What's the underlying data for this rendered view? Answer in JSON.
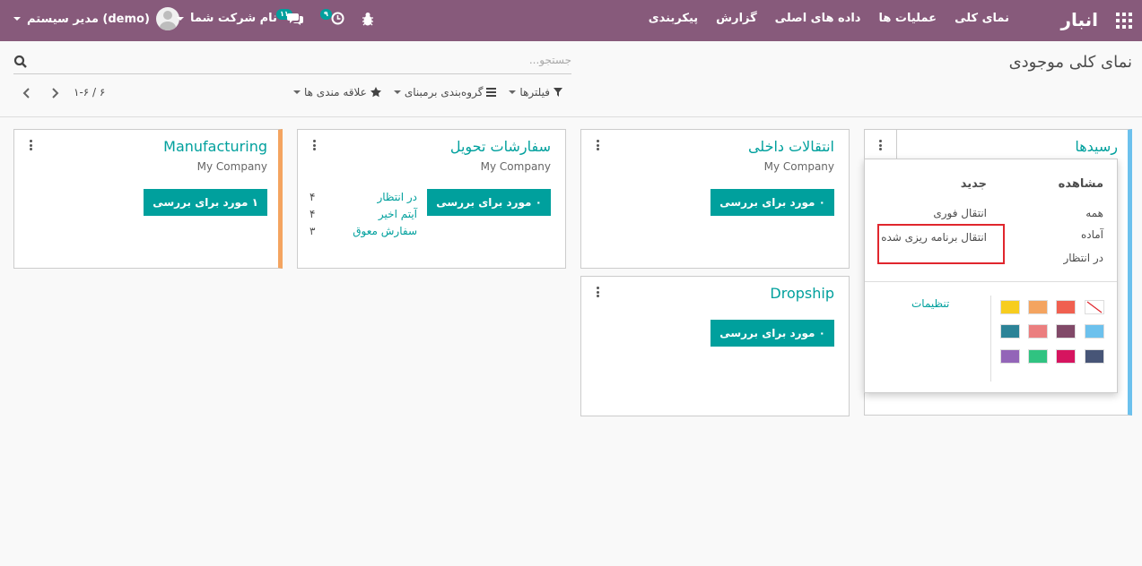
{
  "navbar": {
    "brand": "انبار",
    "menu": [
      "نمای کلی",
      "عملیات ها",
      "داده های اصلی",
      "گزارش",
      "پیکربندی"
    ],
    "user": "مدیر سیستم (demo)",
    "company": "نام شرکت شما",
    "messages_count": "۱۱",
    "activities_count": "۹",
    "color": "#875a7b"
  },
  "control_panel": {
    "title": "نمای کلی موجودی",
    "search_placeholder": "جستجو...",
    "filters_label": "فیلترها",
    "groupby_label": "گروه‌بندی برمبنای",
    "favorites_label": "علاقه مندی ها",
    "pager_value": "۱-۶ / ۶"
  },
  "cards": {
    "receipts": {
      "title": "رسیدها"
    },
    "internal": {
      "title": "انتقالات داخلی",
      "company": "My Company",
      "button": "۰ مورد برای بررسی"
    },
    "delivery": {
      "title": "سفارشات تحویل",
      "company": "My Company",
      "button": "۰ مورد برای بررسی",
      "stats": [
        {
          "label": "در انتظار",
          "count": "۴"
        },
        {
          "label": "آیتم اخیر",
          "count": "۴"
        },
        {
          "label": "سفارش معوق",
          "count": "۳"
        }
      ]
    },
    "manufacturing": {
      "title": "Manufacturing",
      "company": "My Company",
      "button": "۱ مورد برای بررسی"
    },
    "dropship": {
      "title": "Dropship",
      "button": "۰ مورد برای بررسی"
    }
  },
  "dropdown": {
    "view_header": "مشاهده",
    "new_header": "جدید",
    "view_items": [
      "همه",
      "آماده",
      "در انتظار"
    ],
    "new_items": [
      "انتقال فوری",
      "انتقال برنامه ریزی شده"
    ],
    "settings": "تنظیمات",
    "swatches": [
      "none",
      "#f06050",
      "#f4a460",
      "#f7cd1f",
      "#6cc1ed",
      "#814968",
      "#eb7e7f",
      "#2c8397",
      "#475577",
      "#d6145f",
      "#30c381",
      "#9365b8"
    ]
  }
}
